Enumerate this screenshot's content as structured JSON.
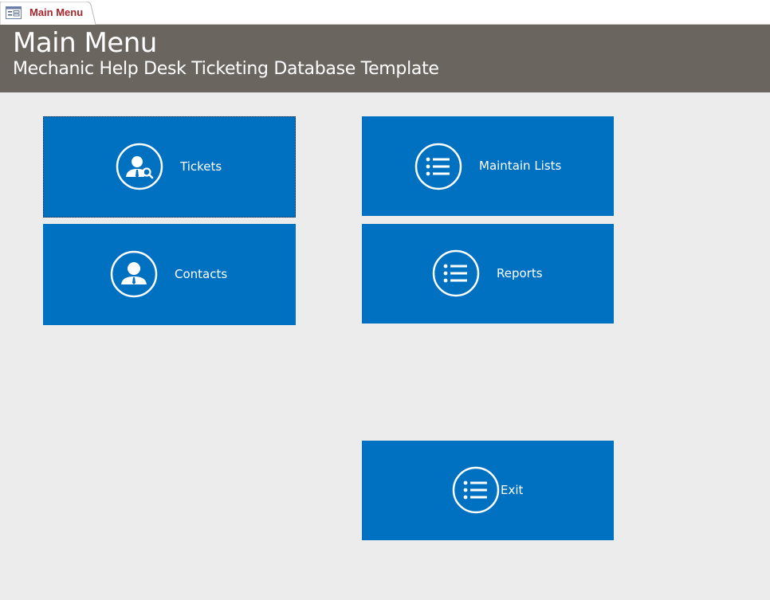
{
  "tab": {
    "label": "Main Menu",
    "icon": "form-icon"
  },
  "header": {
    "title": "Main Menu",
    "subtitle": "Mechanic Help Desk Ticketing Database Template"
  },
  "tiles": {
    "tickets": {
      "label": "Tickets",
      "icon": "user-search-icon"
    },
    "contacts": {
      "label": "Contacts",
      "icon": "user-icon"
    },
    "maintain_lists": {
      "label": "Maintain Lists",
      "icon": "list-icon"
    },
    "reports": {
      "label": "Reports",
      "icon": "list-icon"
    },
    "exit": {
      "label": "Exit",
      "icon": "list-icon"
    }
  },
  "colors": {
    "tile": "#0070c0",
    "header": "#6a655f",
    "background": "#ececec",
    "tab_label": "#a4262c"
  }
}
